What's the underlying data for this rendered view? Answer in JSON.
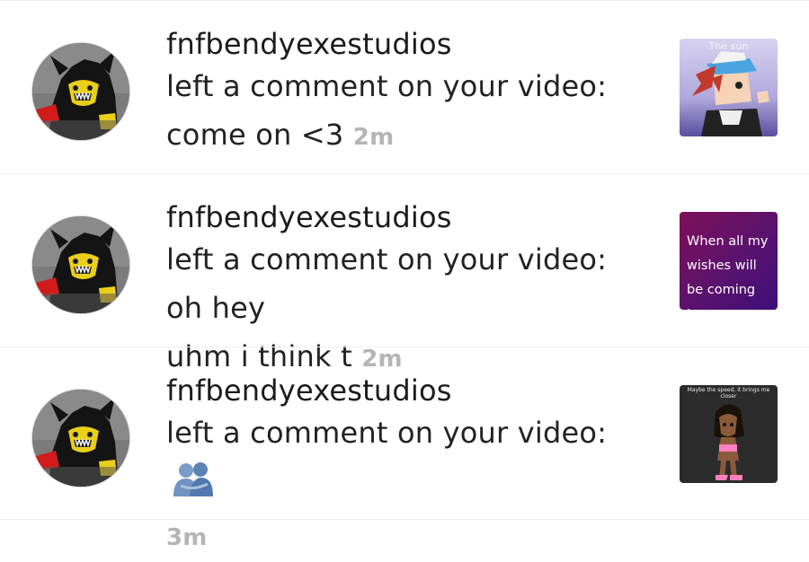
{
  "notifications": [
    {
      "username": "fnfbendyexestudios",
      "action": "left a comment on your video:",
      "comment": "come on <3",
      "time": "2m",
      "thumbnail": {
        "caption": "The sun",
        "style": "cartoon-character"
      }
    },
    {
      "username": "fnfbendyexestudios",
      "action": "left a comment on your video:",
      "comment": "oh hey uhm i think t",
      "time": "2m",
      "thumbnail": {
        "caption": "When all my wishes will be coming true",
        "style": "purple-text-card"
      }
    },
    {
      "username": "fnfbendyexestudios",
      "action": "left a comment on your video:",
      "comment_emoji": "hugging-people-emoji",
      "time": "3m",
      "thumbnail": {
        "caption": "Maybe the speed, it brings me closer",
        "style": "dark-cartoon-character"
      }
    }
  ],
  "colors": {
    "text": "#1b1b1b",
    "timestamp": "#b5b5b5",
    "divider": "#efefef"
  }
}
